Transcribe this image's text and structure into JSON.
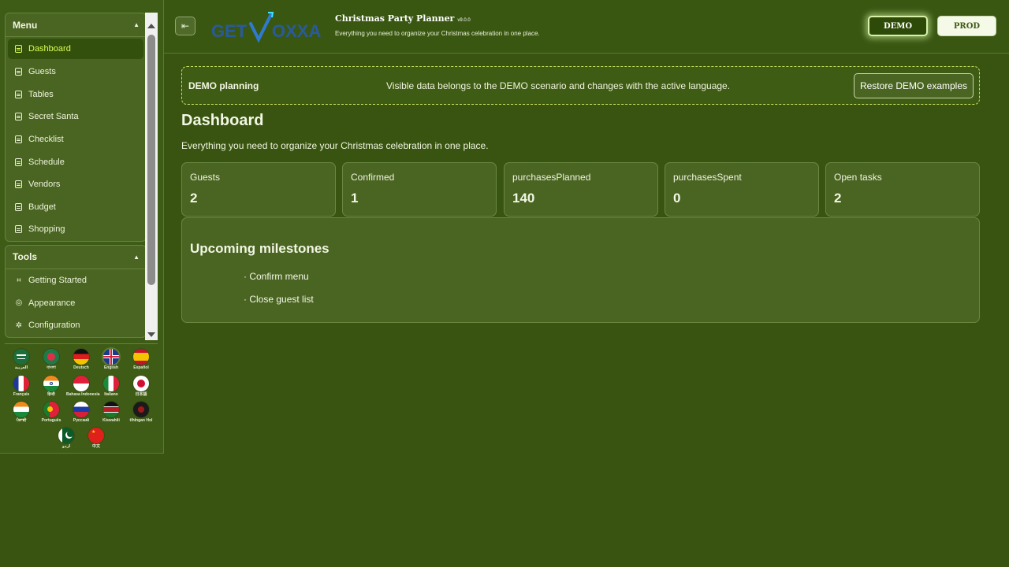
{
  "sidebar": {
    "menu_title": "Menu",
    "menu_items": [
      {
        "label": "Dashboard",
        "active": true
      },
      {
        "label": "Guests"
      },
      {
        "label": "Tables"
      },
      {
        "label": "Secret Santa"
      },
      {
        "label": "Checklist"
      },
      {
        "label": "Schedule"
      },
      {
        "label": "Vendors"
      },
      {
        "label": "Budget"
      },
      {
        "label": "Shopping"
      }
    ],
    "tools_title": "Tools",
    "tool_items": [
      {
        "label": "Getting Started",
        "icon": "plug-icon"
      },
      {
        "label": "Appearance",
        "icon": "palette-icon"
      },
      {
        "label": "Configuration",
        "icon": "gear-icon"
      }
    ],
    "languages": [
      {
        "name": "العربية",
        "code": "ar"
      },
      {
        "name": "বাংলা",
        "code": "bn"
      },
      {
        "name": "Deutsch",
        "code": "de"
      },
      {
        "name": "English",
        "code": "en",
        "selected": true
      },
      {
        "name": "Español",
        "code": "es"
      },
      {
        "name": "Français",
        "code": "fr"
      },
      {
        "name": "हिन्दी",
        "code": "hi"
      },
      {
        "name": "Bahasa Indonesia",
        "code": "id"
      },
      {
        "name": "Italiano",
        "code": "it"
      },
      {
        "name": "日本語",
        "code": "ja"
      },
      {
        "name": "ਪੰਜਾਬੀ",
        "code": "pa"
      },
      {
        "name": "Português",
        "code": "pt"
      },
      {
        "name": "Русский",
        "code": "ru"
      },
      {
        "name": "Kiswahili",
        "code": "sw"
      },
      {
        "name": "tlhIngan Hol",
        "code": "tlh"
      },
      {
        "name": "اردو",
        "code": "ur"
      },
      {
        "name": "中文",
        "code": "zh"
      }
    ]
  },
  "header": {
    "logo_text": "GETVOXXA",
    "app_title": "Christmas Party Planner",
    "app_version": "v9.0.0",
    "app_subtitle": "Everything you need to organize your Christmas celebration in one place.",
    "demo_label": "DEMO",
    "prod_label": "PROD"
  },
  "banner": {
    "title": "DEMO planning",
    "text": "Visible data belongs to the DEMO scenario and changes with the active language.",
    "restore_label": "Restore DEMO examples"
  },
  "main": {
    "title": "Dashboard",
    "subtitle": "Everything you need to organize your Christmas celebration in one place.",
    "stats": [
      {
        "label": "Guests",
        "value": "2"
      },
      {
        "label": "Confirmed",
        "value": "1"
      },
      {
        "label": "purchasesPlanned",
        "value": "140"
      },
      {
        "label": "purchasesSpent",
        "value": "0"
      },
      {
        "label": "Open tasks",
        "value": "2"
      }
    ],
    "milestones_title": "Upcoming milestones",
    "milestones": [
      {
        "date": "",
        "text": "· Confirm menu"
      },
      {
        "date": "",
        "text": "· Close guest list"
      }
    ]
  },
  "colors": {
    "background": "#385410",
    "card": "#4a6522",
    "accent_active": "#d8ff54"
  }
}
